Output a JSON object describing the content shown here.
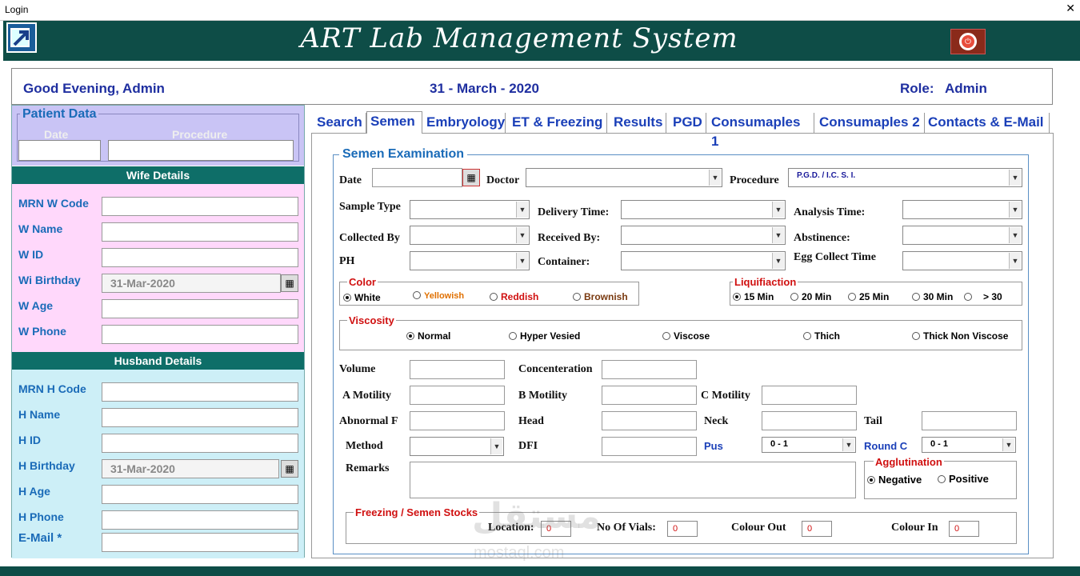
{
  "window": {
    "title": "Login"
  },
  "app": {
    "title": "ART Lab Management System"
  },
  "welcome": {
    "greeting": "Good Evening, Admin",
    "date": "31 - March - 2020",
    "role_label": "Role:",
    "role_value": "Admin"
  },
  "patient_data": {
    "legend": "Patient Data",
    "date_label": "Date",
    "procedure_label": "Procedure",
    "date_value": "",
    "procedure_value": ""
  },
  "wife": {
    "header": "Wife Details",
    "fields": [
      {
        "label": "MRN W Code",
        "value": ""
      },
      {
        "label": "W Name",
        "value": ""
      },
      {
        "label": "W ID",
        "value": ""
      },
      {
        "label": "Wi Birthday",
        "value": "31-Mar-2020"
      },
      {
        "label": "W Age",
        "value": ""
      },
      {
        "label": "W Phone",
        "value": ""
      }
    ]
  },
  "husband": {
    "header": "Husband Details",
    "fields": [
      {
        "label": "MRN H Code",
        "value": ""
      },
      {
        "label": "H Name",
        "value": ""
      },
      {
        "label": "H ID",
        "value": ""
      },
      {
        "label": "H Birthday",
        "value": "31-Mar-2020"
      },
      {
        "label": "H Age",
        "value": ""
      },
      {
        "label": "H Phone",
        "value": ""
      },
      {
        "label": "E-Mail *",
        "value": ""
      }
    ]
  },
  "tabs": [
    {
      "label": "Search",
      "active": false
    },
    {
      "label": "Semen",
      "active": true
    },
    {
      "label": "Embryology",
      "active": false
    },
    {
      "label": "ET & Freezing",
      "active": false
    },
    {
      "label": "Results",
      "active": false
    },
    {
      "label": "PGD",
      "active": false
    },
    {
      "label": "Consumaples 1",
      "active": false
    },
    {
      "label": "Consumaples 2",
      "active": false
    },
    {
      "label": "Contacts & E-Mail",
      "active": false
    }
  ],
  "semen": {
    "legend": "Semen Examination",
    "date_label": "Date",
    "doctor_label": "Doctor",
    "procedure_label": "Procedure",
    "procedure_value": "P.G.D.  /   I.C. S. I.",
    "sample_type_label": "Sample Type",
    "delivery_time_label": "Delivery Time:",
    "analysis_time_label": "Analysis Time:",
    "collected_by_label": "Collected By",
    "received_by_label": "Received By:",
    "abstinence_label": "Abstinence:",
    "ph_label": "PH",
    "container_label": "Container:",
    "egg_collect_label": "Egg Collect Time",
    "color": {
      "legend": "Color",
      "options": [
        "White",
        "Yellowish",
        "Reddish",
        "Brownish"
      ],
      "selected": "White",
      "option_colors": [
        "#111111",
        "#e07000",
        "#d01010",
        "#7a3a10"
      ]
    },
    "liquifaction": {
      "legend": "Liquifiaction",
      "options": [
        "15 Min",
        "20 Min",
        "25 Min",
        "30 Min",
        "> 30"
      ],
      "selected": "15 Min"
    },
    "viscosity": {
      "legend": "Viscosity",
      "options": [
        "Normal",
        "Hyper Vesied",
        "Viscose",
        "Thich",
        "Thick Non Viscose"
      ],
      "selected": "Normal"
    },
    "volume_label": "Volume",
    "concentration_label": "Concenteration",
    "a_motility_label": "A Motility",
    "b_motility_label": "B Motility",
    "c_motility_label": "C Motility",
    "abnormal_label": "Abnormal F",
    "head_label": "Head",
    "neck_label": "Neck",
    "tail_label": "Tail",
    "method_label": "Method",
    "dfi_label": "DFI",
    "pus_label": "Pus",
    "pus_value": "0  -  1",
    "round_label": "Round C",
    "round_value": "0  -  1",
    "remarks_label": "Remarks",
    "agglutination": {
      "legend": "Agglutination",
      "options": [
        "Negative",
        "Positive"
      ],
      "selected": "Negative"
    },
    "freezing": {
      "legend": "Freezing / Semen Stocks",
      "location_label": "Location:",
      "location_value": "0",
      "vials_label": "No Of Vials:",
      "vials_value": "0",
      "colour_out_label": "Colour Out",
      "colour_out_value": "0",
      "colour_in_label": "Colour In",
      "colour_in_value": "0"
    }
  },
  "watermark": {
    "arabic": "مستقل",
    "latin": "mostaql.com"
  }
}
